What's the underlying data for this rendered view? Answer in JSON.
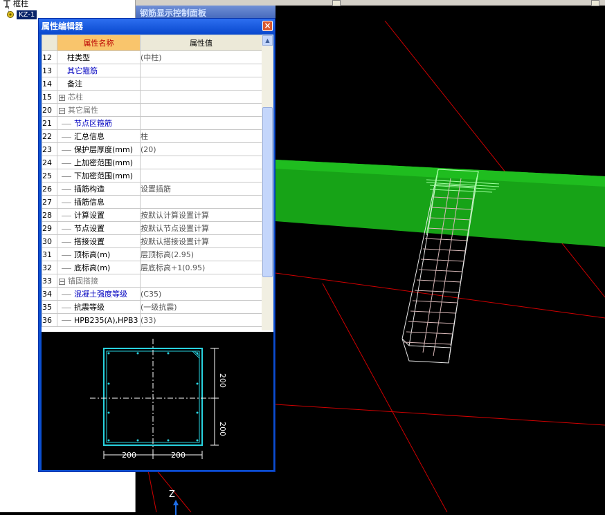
{
  "tree": {
    "root_label": "框柱",
    "child_label": "KZ-1"
  },
  "background_panel_title": "钢筋显示控制面板",
  "dialog": {
    "title": "属性编辑器",
    "close_label": "×",
    "columns": {
      "name": "属性名称",
      "value": "属性值"
    },
    "rows": [
      {
        "num": "12",
        "name": "柱类型",
        "value": "(中柱)",
        "style": "plain"
      },
      {
        "num": "13",
        "name": "其它箍筋",
        "value": "",
        "style": "blue"
      },
      {
        "num": "14",
        "name": "备注",
        "value": "",
        "style": "plain"
      },
      {
        "num": "15",
        "name": "芯柱",
        "value": "",
        "style": "group-collapsed"
      },
      {
        "num": "20",
        "name": "其它属性",
        "value": "",
        "style": "group-expanded"
      },
      {
        "num": "21",
        "name": "节点区箍筋",
        "value": "",
        "style": "child-blue"
      },
      {
        "num": "22",
        "name": "汇总信息",
        "value": "柱",
        "style": "child"
      },
      {
        "num": "23",
        "name": "保护层厚度(mm)",
        "value": "(20)",
        "style": "child"
      },
      {
        "num": "24",
        "name": "上加密范围(mm)",
        "value": "",
        "style": "child"
      },
      {
        "num": "25",
        "name": "下加密范围(mm)",
        "value": "",
        "style": "child"
      },
      {
        "num": "26",
        "name": "插筋构造",
        "value": "设置插筋",
        "style": "child"
      },
      {
        "num": "27",
        "name": "插筋信息",
        "value": "",
        "style": "child"
      },
      {
        "num": "28",
        "name": "计算设置",
        "value": "按默认计算设置计算",
        "style": "child"
      },
      {
        "num": "29",
        "name": "节点设置",
        "value": "按默认节点设置计算",
        "style": "child"
      },
      {
        "num": "30",
        "name": "搭接设置",
        "value": "按默认搭接设置计算",
        "style": "child"
      },
      {
        "num": "31",
        "name": "顶标高(m)",
        "value": "层顶标高(2.95)",
        "style": "child"
      },
      {
        "num": "32",
        "name": "底标高(m)",
        "value": "层底标高+1(0.95)",
        "style": "child"
      },
      {
        "num": "33",
        "name": "锚固搭接",
        "value": "",
        "style": "group-expanded"
      },
      {
        "num": "34",
        "name": "混凝土强度等级",
        "value": "(C35)",
        "style": "child-blue"
      },
      {
        "num": "35",
        "name": "抗震等级",
        "value": "(一级抗震)",
        "style": "child"
      },
      {
        "num": "36",
        "name": "HPB235(A),HPB3",
        "value": "(33)",
        "style": "child"
      }
    ],
    "preview": {
      "dim_top": "200",
      "dim_bottom": "200",
      "dim_left": "200",
      "dim_right": "200"
    }
  },
  "axis_label": "Z",
  "colors": {
    "beam": "#17a317",
    "column_wire": "#e8e8e8",
    "grid_line": "#d00000",
    "section_outline": "#29d3e0"
  }
}
